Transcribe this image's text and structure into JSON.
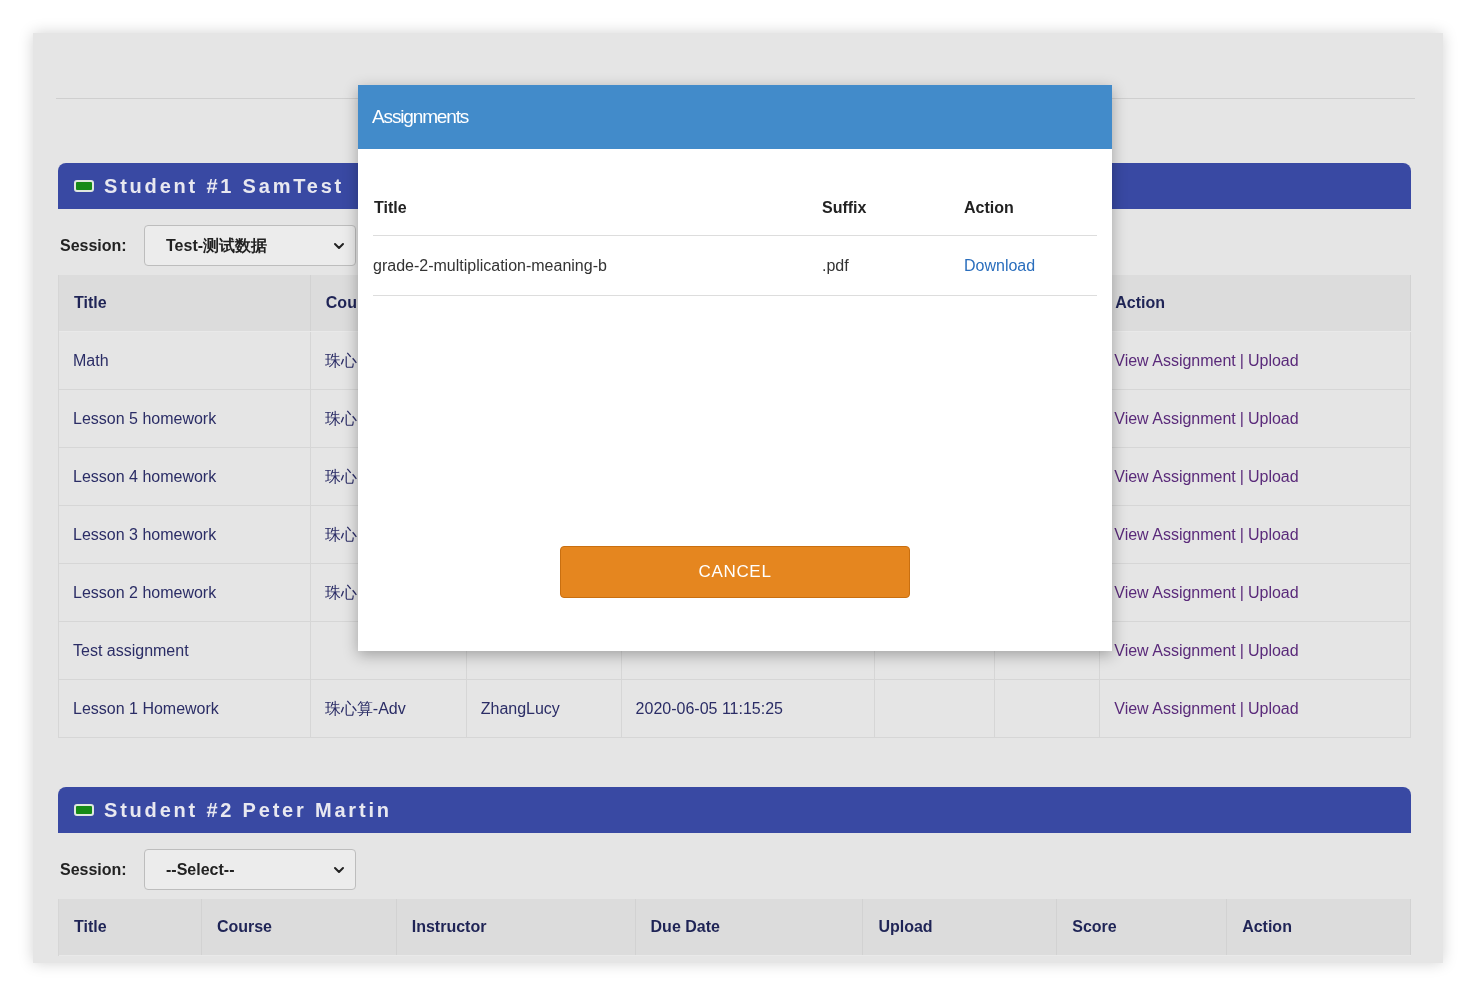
{
  "students": [
    {
      "heading": "Student #1 SamTest",
      "session_label": "Session:",
      "session_value": "Test-测试数据",
      "columns": {
        "title": "Title",
        "course": "Cou",
        "action": "Action"
      },
      "rows": [
        {
          "title": "Math",
          "course": "珠心",
          "links": [
            "View Assignment",
            "Upload"
          ],
          "separator": "|"
        },
        {
          "title": "Lesson 5 homework",
          "course": "珠心",
          "links": [
            "View Assignment",
            "Upload"
          ],
          "separator": "|"
        },
        {
          "title": "Lesson 4 homework",
          "course": "珠心",
          "links": [
            "View Assignment",
            "Upload"
          ],
          "separator": "|"
        },
        {
          "title": "Lesson 3 homework",
          "course": "珠心",
          "links": [
            "View Assignment",
            "Upload"
          ],
          "separator": "|"
        },
        {
          "title": "Lesson 2 homework",
          "course": "珠心",
          "links": [
            "View Assignment",
            "Upload"
          ],
          "separator": "|"
        },
        {
          "title": "Test assignment",
          "links": [
            "View Assignment",
            "Upload"
          ],
          "separator": "|"
        },
        {
          "title": "Lesson 1 Homework",
          "course": "珠心算-Adv",
          "instructor": "ZhangLucy",
          "due_date": "2020-06-05 11:15:25",
          "links": [
            "View Assignment",
            "Upload"
          ],
          "separator": "|"
        }
      ]
    },
    {
      "heading": "Student #2 Peter Martin",
      "session_label": "Session:",
      "session_value": "--Select--",
      "columns": {
        "title": "Title",
        "course": "Course",
        "instructor": "Instructor",
        "due_date": "Due Date",
        "upload": "Upload",
        "score": "Score",
        "action": "Action"
      }
    }
  ],
  "modal": {
    "title": "Assignments",
    "columns": [
      "Title",
      "Suffix",
      "Action"
    ],
    "rows": [
      {
        "title": "grade-2-multiplication-meaning-b",
        "suffix": ".pdf",
        "action": "Download"
      }
    ],
    "cancel": "CANCEL"
  }
}
